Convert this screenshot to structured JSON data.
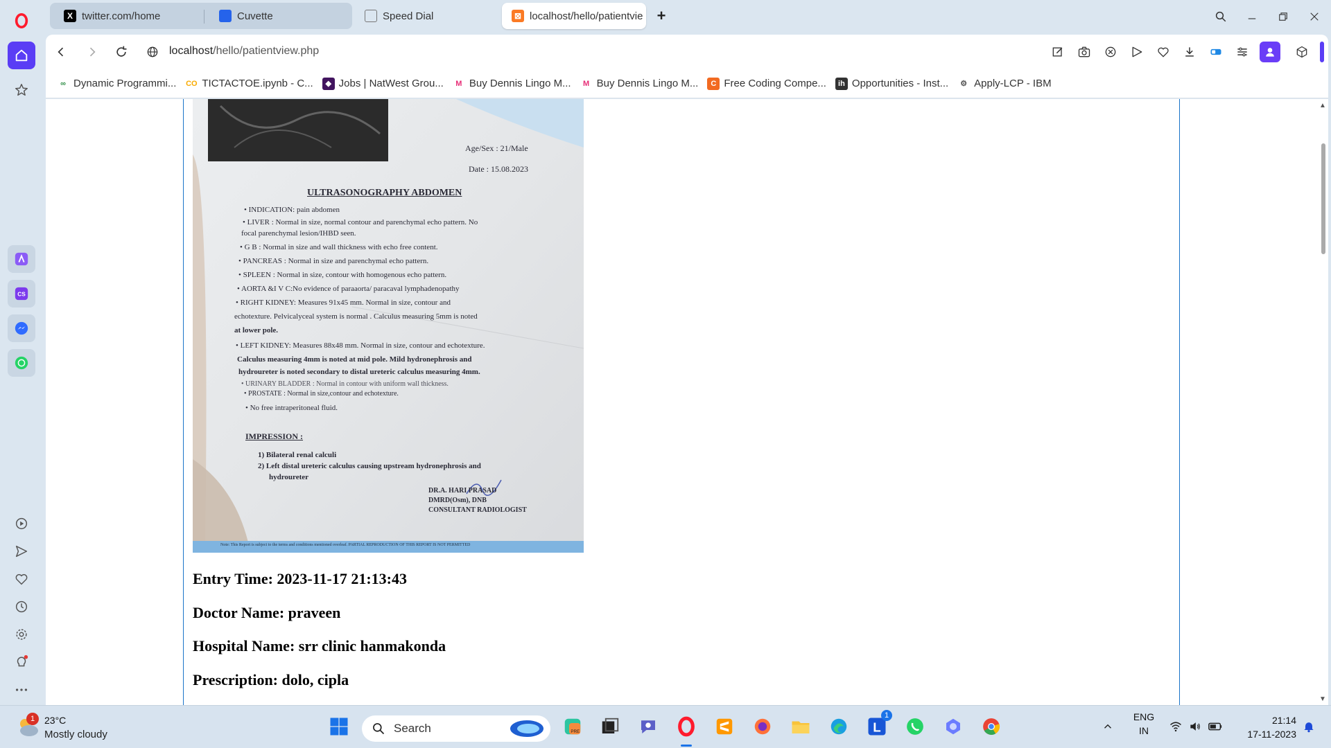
{
  "browser": {
    "tabs": [
      {
        "label": "twitter.com/home",
        "icon": "x-icon"
      },
      {
        "label": "Cuvette",
        "icon": "cuvette-icon"
      },
      {
        "label": "Speed Dial",
        "icon": "speed-dial-icon"
      },
      {
        "label": "localhost/hello/patientvie",
        "icon": "xampp-icon",
        "active": true
      }
    ],
    "address": {
      "host": "localhost",
      "path": "/hello/patientview.php"
    },
    "bookmarks": [
      {
        "label": "Dynamic Programmi...",
        "icon": "gfg-icon",
        "color": "#2f8d46"
      },
      {
        "label": "TICTACTOE.ipynb - C...",
        "icon": "colab-icon",
        "color": "#f9ab00"
      },
      {
        "label": "Jobs | NatWest Grou...",
        "icon": "natwest-icon",
        "color": "#42145f"
      },
      {
        "label": "Buy Dennis Lingo M...",
        "icon": "myntra-icon",
        "color": "#e72e77"
      },
      {
        "label": "Buy Dennis Lingo M...",
        "icon": "myntra-icon",
        "color": "#e72e77"
      },
      {
        "label": "Free Coding Compe...",
        "icon": "coding-icon",
        "color": "#f26a21"
      },
      {
        "label": "Opportunities - Inst...",
        "icon": "ih-icon",
        "color": "#333333"
      },
      {
        "label": "Apply-LCP - IBM",
        "icon": "ibm-icon",
        "color": "#555555"
      }
    ]
  },
  "report": {
    "age_sex": "Age/Sex : 21/Male",
    "date": "Date : 15.08.2023",
    "title": "ULTRASONOGRAPHY ABDOMEN",
    "lines": [
      "• INDICATION: pain abdomen",
      "• LIVER : Normal in size, normal contour and parenchymal echo pattern. No",
      "focal parenchymal lesion/IHBD seen.",
      "• G B : Normal in size and wall thickness with echo free content.",
      "• PANCREAS : Normal in size and parenchymal echo pattern.",
      "• SPLEEN : Normal in size, contour with homogenous echo pattern.",
      "• AORTA &I V C:No evidence of paraaorta/ paracaval lymphadenopathy",
      "• RIGHT KIDNEY: Measures 91x45 mm. Normal in size, contour and",
      "echotexture. Pelvicalyceal system is normal . Calculus measuring 5mm is noted",
      "at lower pole.",
      "• LEFT KIDNEY: Measures 88x48 mm. Normal in size, contour and echotexture.",
      "Calculus measuring 4mm is noted at mid pole. Mild hydronephrosis and",
      "hydroureter is noted secondary to distal ureteric calculus measuring 4mm.",
      "• URINARY BLADDER : Normal in contour with uniform wall thickness.",
      "• PROSTATE : Normal in size,contour and echotexture.",
      "• No free intraperitoneal fluid."
    ],
    "impression_heading": "IMPRESSION :",
    "impressions": [
      "1) Bilateral renal calculi",
      "2) Left distal ureteric calculus causing upstream hydronephrosis and",
      "hydroureter"
    ],
    "signatory": [
      "DR.A. HARI PRASAD",
      "DMRD(Osm), DNB",
      "CONSULTANT RADIOLOGIST"
    ],
    "footer_note": "Note: This Report is subject to the terms and conditions mentioned overleaf. PARTIAL REPRODUCTION OF THIS REPORT IS NOT PERMITTED"
  },
  "patient": {
    "entry_time": "Entry Time: 2023-11-17 21:13:43",
    "doctor": "Doctor Name: praveen",
    "hospital": "Hospital Name: srr clinic hanmakonda",
    "prescription": "Prescription: dolo, cipla"
  },
  "taskbar": {
    "weather_temp": "23°C",
    "weather_desc": "Mostly cloudy",
    "weather_badge": "1",
    "search_placeholder": "Search",
    "lang": "ENG",
    "region": "IN",
    "time": "21:14",
    "date": "17-11-2023",
    "mail_badge": "1"
  }
}
